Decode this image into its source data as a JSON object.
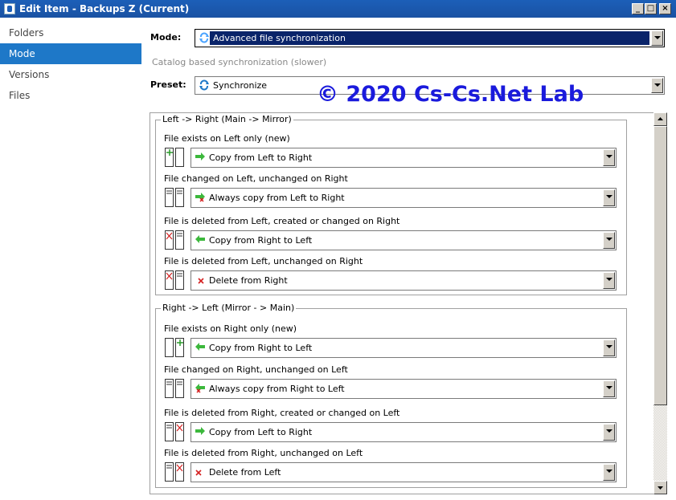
{
  "window": {
    "title": "Edit Item - Backups Z (Current)"
  },
  "sidebar": {
    "items": [
      {
        "label": "Folders",
        "active": false
      },
      {
        "label": "Mode",
        "active": true
      },
      {
        "label": "Versions",
        "active": false
      },
      {
        "label": "Files",
        "active": false
      }
    ]
  },
  "mode": {
    "label": "Mode:",
    "value": "Advanced file synchronization",
    "icon": "sync-icon",
    "note": "Catalog based synchronization (slower)"
  },
  "preset": {
    "label": "Preset:",
    "value": "Synchronize",
    "icon": "sync-icon"
  },
  "watermark": "© 2020 Cs-Cs.Net Lab",
  "groups": [
    {
      "title": "Left -> Right (Main -> Mirror)",
      "rows": [
        {
          "label": "File exists on Left only (new)",
          "value": "Copy from Left to Right",
          "icon": "arrow-right-icon"
        },
        {
          "label": "File changed on Left, unchanged on Right",
          "value": "Always copy from Left to Right",
          "icon": "arrow-right-force-icon"
        },
        {
          "label": "File is deleted from Left, created or changed on Right",
          "value": "Copy from Right to Left",
          "icon": "arrow-left-icon"
        },
        {
          "label": "File is deleted from Left, unchanged on Right",
          "value": "Delete from Right",
          "icon": "delete-icon"
        }
      ]
    },
    {
      "title": "Right -> Left (Mirror - > Main)",
      "rows": [
        {
          "label": "File exists on Right only (new)",
          "value": "Copy from Right to Left",
          "icon": "arrow-left-icon"
        },
        {
          "label": "File changed on Right, unchanged on Left",
          "value": "Always copy from Right to Left",
          "icon": "arrow-left-force-icon"
        },
        {
          "label": "File is deleted from Right, created or changed on Left",
          "value": "Copy from Left to Right",
          "icon": "arrow-right-icon"
        },
        {
          "label": "File is deleted from Right, unchanged on Left",
          "value": "Delete from Left",
          "icon": "delete-icon"
        }
      ]
    }
  ],
  "colors": {
    "accent": "#1e78c8",
    "selection": "#0a246a",
    "arrow": "#3cb83c",
    "delete": "#d42020",
    "watermark": "#1a1adc"
  }
}
